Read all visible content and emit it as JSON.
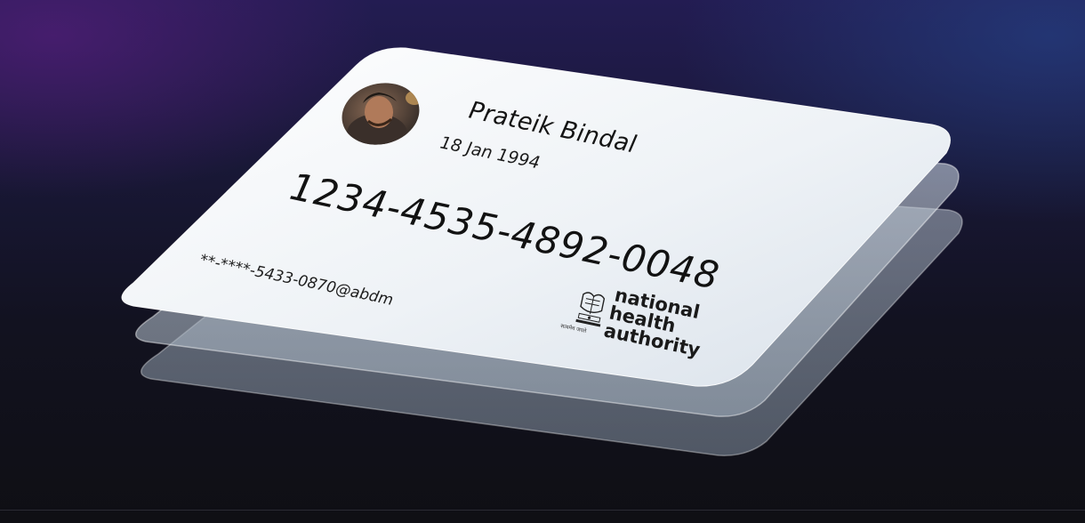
{
  "card": {
    "holder_name": "Prateik Bindal",
    "date_of_birth": "18 Jan 1994",
    "abha_number": "1234-4535-4892-0048",
    "abha_address": "**-****-5433-0870@abdm",
    "issuer_logo": {
      "line1": "national",
      "line2": "health",
      "line3": "authority",
      "emblem_caption": "सत्यमेव जयते"
    }
  },
  "colors": {
    "background_top_left": "#3b1c62",
    "background_top_right": "#203466",
    "background_bottom": "#0f0f14",
    "card_face": "#f4f6f8",
    "card_text": "#141414"
  },
  "icons": {
    "avatar": "profile-photo",
    "emblem": "national-emblem-icon"
  }
}
